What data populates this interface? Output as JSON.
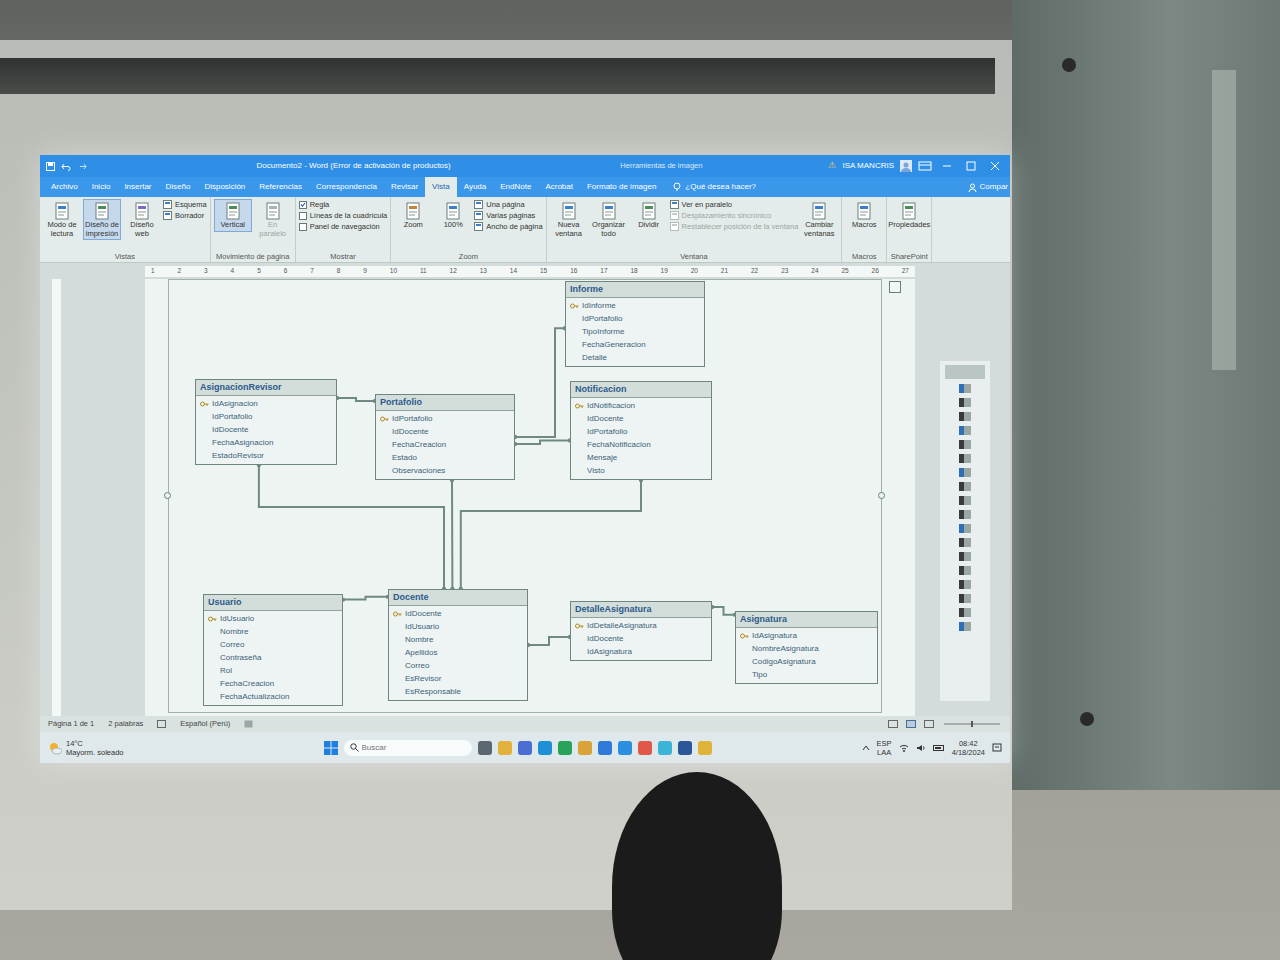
{
  "window": {
    "title": "Documento2 - Word (Error de activación de productos)",
    "context_tab": "Herramientas de imagen",
    "warning": "⚠",
    "user": "ISA MANCRIS"
  },
  "tabs": [
    {
      "label": "Archivo",
      "selected": false
    },
    {
      "label": "Inicio",
      "selected": false
    },
    {
      "label": "Insertar",
      "selected": false
    },
    {
      "label": "Diseño",
      "selected": false
    },
    {
      "label": "Disposición",
      "selected": false
    },
    {
      "label": "Referencias",
      "selected": false
    },
    {
      "label": "Correspondencia",
      "selected": false
    },
    {
      "label": "Revisar",
      "selected": false
    },
    {
      "label": "Vista",
      "selected": true
    },
    {
      "label": "Ayuda",
      "selected": false
    },
    {
      "label": "EndNote",
      "selected": false
    },
    {
      "label": "Acrobat",
      "selected": false
    },
    {
      "label": "Formato de imagen",
      "selected": false
    }
  ],
  "tell_me": "¿Qué desea hacer?",
  "share": "Compar",
  "ribbon": {
    "groups": [
      {
        "label": "Vistas",
        "items": [
          {
            "kind": "large",
            "label": "Modo de lectura",
            "selected": false,
            "disabled": false
          },
          {
            "kind": "large",
            "label": "Diseño de impresión",
            "selected": true,
            "disabled": false
          },
          {
            "kind": "large",
            "label": "Diseño web",
            "selected": false,
            "disabled": false
          },
          {
            "kind": "small",
            "label": "Esquema",
            "disabled": false
          },
          {
            "kind": "small",
            "label": "Borrador",
            "disabled": false
          }
        ]
      },
      {
        "label": "Movimiento de página",
        "items": [
          {
            "kind": "large",
            "label": "Vertical",
            "selected": true,
            "disabled": false
          },
          {
            "kind": "large",
            "label": "En paralelo",
            "selected": false,
            "disabled": true
          }
        ]
      },
      {
        "label": "Mostrar",
        "items": [
          {
            "kind": "check",
            "label": "Regla",
            "checked": true
          },
          {
            "kind": "check",
            "label": "Líneas de la cuadrícula",
            "checked": false
          },
          {
            "kind": "check",
            "label": "Panel de navegación",
            "checked": false
          }
        ]
      },
      {
        "label": "Zoom",
        "items": [
          {
            "kind": "large",
            "label": "Zoom",
            "selected": false,
            "disabled": false
          },
          {
            "kind": "large",
            "label": "100%",
            "selected": false,
            "disabled": false
          },
          {
            "kind": "small",
            "label": "Una página",
            "disabled": false
          },
          {
            "kind": "small",
            "label": "Varias páginas",
            "disabled": false
          },
          {
            "kind": "small",
            "label": "Ancho de página",
            "disabled": false
          }
        ]
      },
      {
        "label": "Ventana",
        "items": [
          {
            "kind": "large",
            "label": "Nueva ventana",
            "selected": false,
            "disabled": false
          },
          {
            "kind": "large",
            "label": "Organizar todo",
            "selected": false,
            "disabled": false
          },
          {
            "kind": "large",
            "label": "Dividir",
            "selected": false,
            "disabled": false
          },
          {
            "kind": "small",
            "label": "Ver en paralelo",
            "disabled": false
          },
          {
            "kind": "small",
            "label": "Desplazamiento sincrónico",
            "disabled": true
          },
          {
            "kind": "small",
            "label": "Restablecer posición de la ventana",
            "disabled": true
          },
          {
            "kind": "large",
            "label": "Cambiar ventanas",
            "selected": false,
            "disabled": false
          }
        ]
      },
      {
        "label": "Macros",
        "items": [
          {
            "kind": "large",
            "label": "Macros",
            "selected": false,
            "disabled": false
          }
        ]
      },
      {
        "label": "SharePoint",
        "items": [
          {
            "kind": "large",
            "label": "Propiedades",
            "selected": false,
            "disabled": false
          }
        ]
      }
    ]
  },
  "ruler": [
    "1",
    "2",
    "3",
    "4",
    "5",
    "6",
    "7",
    "8",
    "9",
    "10",
    "11",
    "12",
    "13",
    "14",
    "15",
    "16",
    "17",
    "18",
    "19",
    "20",
    "21",
    "22",
    "23",
    "24",
    "25",
    "26",
    "27"
  ],
  "diagram": {
    "selected": true,
    "tables": [
      {
        "name": "Informe",
        "fields": [
          {
            "name": "IdInforme",
            "key": true
          },
          {
            "name": "IdPortafolio",
            "key": false
          },
          {
            "name": "TipoInforme",
            "key": false
          },
          {
            "name": "FechaGeneracion",
            "key": false
          },
          {
            "name": "Detalle",
            "key": false
          }
        ]
      },
      {
        "name": "AsignacionRevisor",
        "fields": [
          {
            "name": "IdAsignacion",
            "key": true
          },
          {
            "name": "IdPortafolio",
            "key": false
          },
          {
            "name": "IdDocente",
            "key": false
          },
          {
            "name": "FechaAsignacion",
            "key": false
          },
          {
            "name": "EstadoRevisor",
            "key": false
          }
        ]
      },
      {
        "name": "Portafolio",
        "fields": [
          {
            "name": "IdPortafolio",
            "key": true
          },
          {
            "name": "IdDocente",
            "key": false
          },
          {
            "name": "FechaCreacion",
            "key": false
          },
          {
            "name": "Estado",
            "key": false
          },
          {
            "name": "Observaciones",
            "key": false
          }
        ]
      },
      {
        "name": "Notificacion",
        "fields": [
          {
            "name": "IdNotificacion",
            "key": true
          },
          {
            "name": "IdDocente",
            "key": false
          },
          {
            "name": "IdPortafolio",
            "key": false
          },
          {
            "name": "FechaNotificacion",
            "key": false
          },
          {
            "name": "Mensaje",
            "key": false
          },
          {
            "name": "Visto",
            "key": false
          }
        ]
      },
      {
        "name": "Usuario",
        "fields": [
          {
            "name": "IdUsuario",
            "key": true
          },
          {
            "name": "Nombre",
            "key": false
          },
          {
            "name": "Correo",
            "key": false
          },
          {
            "name": "Contraseña",
            "key": false
          },
          {
            "name": "Rol",
            "key": false
          },
          {
            "name": "FechaCreacion",
            "key": false
          },
          {
            "name": "FechaActualizacion",
            "key": false
          }
        ]
      },
      {
        "name": "Docente",
        "fields": [
          {
            "name": "IdDocente",
            "key": true
          },
          {
            "name": "IdUsuario",
            "key": false
          },
          {
            "name": "Nombre",
            "key": false
          },
          {
            "name": "Apellidos",
            "key": false
          },
          {
            "name": "Correo",
            "key": false
          },
          {
            "name": "EsRevisor",
            "key": false
          },
          {
            "name": "EsResponsable",
            "key": false
          }
        ]
      },
      {
        "name": "DetalleAsignatura",
        "fields": [
          {
            "name": "IdDetalleAsignatura",
            "key": true
          },
          {
            "name": "IdDocente",
            "key": false
          },
          {
            "name": "IdAsignatura",
            "key": false
          }
        ]
      },
      {
        "name": "Asignatura",
        "fields": [
          {
            "name": "IdAsignatura",
            "key": true
          },
          {
            "name": "NombreAsignatura",
            "key": false
          },
          {
            "name": "CodigoAsignatura",
            "key": false
          },
          {
            "name": "Tipo",
            "key": false
          }
        ]
      }
    ],
    "relations": [
      {
        "from": "AsignacionRevisor",
        "to": "Portafolio"
      },
      {
        "from": "Portafolio",
        "to": "Informe"
      },
      {
        "from": "Portafolio",
        "to": "Notificacion"
      },
      {
        "from": "AsignacionRevisor",
        "to": "Docente"
      },
      {
        "from": "Portafolio",
        "to": "Docente"
      },
      {
        "from": "Notificacion",
        "to": "Docente"
      },
      {
        "from": "Usuario",
        "to": "Docente"
      },
      {
        "from": "DetalleAsignatura",
        "to": "Docente"
      },
      {
        "from": "DetalleAsignatura",
        "to": "Asignatura"
      }
    ]
  },
  "status_bar": {
    "page": "Página 1 de 1",
    "words": "2 palabras",
    "language": "Español (Perú)"
  },
  "taskbar": {
    "weather": {
      "temp": "14°C",
      "desc": "Mayorm. soleado"
    },
    "search": {
      "placeholder": "Buscar"
    },
    "tray": {
      "lang": "ESP",
      "layout": "LAA",
      "time": "08:42",
      "date": "4/18/2024"
    }
  }
}
